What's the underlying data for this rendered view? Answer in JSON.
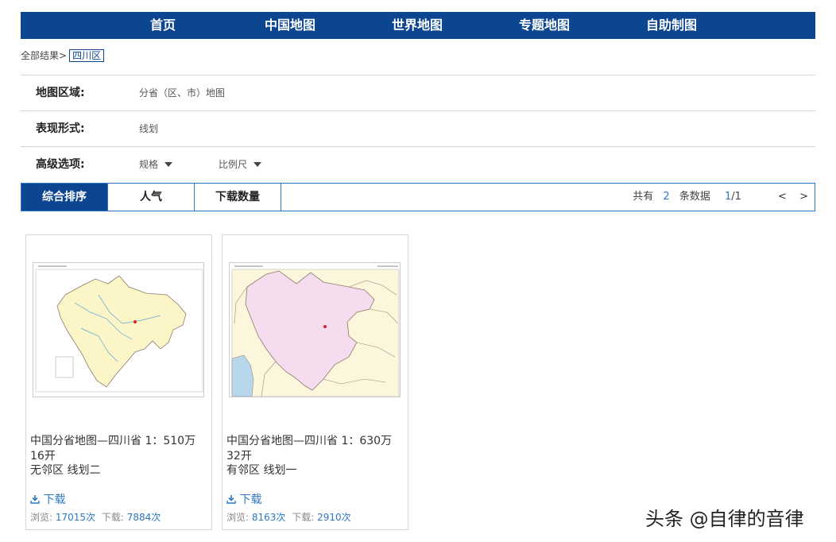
{
  "nav": {
    "items": [
      {
        "label": "首页"
      },
      {
        "label": "中国地图"
      },
      {
        "label": "世界地图"
      },
      {
        "label": "专题地图"
      },
      {
        "label": "自助制图"
      }
    ]
  },
  "breadcrumb": {
    "root": "全部结果>",
    "current": "四川区"
  },
  "filters": {
    "region": {
      "label": "地图区域:",
      "value": "分省（区、市）地图"
    },
    "form": {
      "label": "表现形式:",
      "value": "线划"
    },
    "advanced": {
      "label": "高级选项:",
      "spec": "规格",
      "scale": "比例尺"
    }
  },
  "sort": {
    "tabs": [
      {
        "label": "综合排序",
        "active": true
      },
      {
        "label": "人气",
        "active": false
      },
      {
        "label": "下载数量",
        "active": false
      }
    ]
  },
  "pager": {
    "prefix": "共有",
    "total": "2",
    "suffix": "条数据",
    "page": "1",
    "pages": "/1",
    "prev": "<",
    "next": ">"
  },
  "cards": [
    {
      "title": "中国分省地图—四川省 1：510万 16开",
      "subtitle": "无邻区 线划二",
      "download": "下载",
      "views_label": "浏览:",
      "views": "17015次",
      "downloads_label": "下载:",
      "downloads": "7884次",
      "map_color": "#fbf5c8"
    },
    {
      "title": "中国分省地图—四川省 1：630万 32开",
      "subtitle": "有邻区 线划一",
      "download": "下载",
      "views_label": "浏览:",
      "views": "8163次",
      "downloads_label": "下载:",
      "downloads": "2910次",
      "map_color": "#f6dcef"
    }
  ],
  "watermark": "头条 @自律的音律",
  "colors": {
    "nav_bg": "#0d4690",
    "link": "#2d78c4"
  }
}
